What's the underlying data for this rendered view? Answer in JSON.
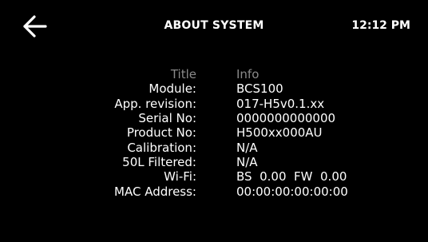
{
  "header": {
    "title": "ABOUT SYSTEM",
    "time": "12:12 PM",
    "back_icon": "arrow-left-icon"
  },
  "table": {
    "head": {
      "label": "Title",
      "value": "Info"
    },
    "rows": [
      {
        "label": "Module:",
        "value": "BCS100"
      },
      {
        "label": "App. revision:",
        "value": "017-H5v0.1.xx"
      },
      {
        "label": "Serial No:",
        "value": "0000000000000"
      },
      {
        "label": "Product No:",
        "value": "H500xx000AU"
      },
      {
        "label": "Calibration:",
        "value": "N/A"
      },
      {
        "label": "50L Filtered:",
        "value": "N/A"
      },
      {
        "label": "Wi-Fi:",
        "value": "BS  0.00  FW  0.00"
      },
      {
        "label": "MAC Address:",
        "value": "00:00:00:00:00:00"
      }
    ]
  },
  "colors": {
    "background": "#000000",
    "text": "#ffffff",
    "muted": "#8a8a8a"
  }
}
